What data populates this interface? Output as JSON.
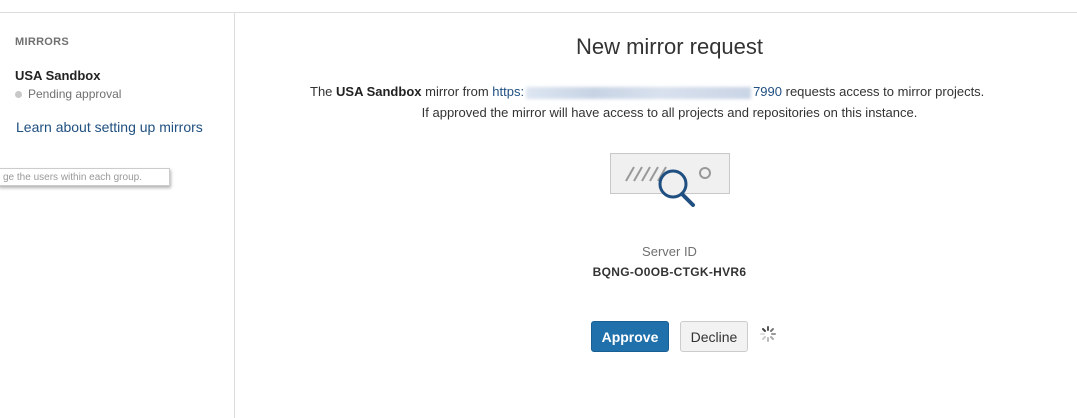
{
  "sidebar": {
    "heading": "MIRRORS",
    "mirror": {
      "name": "USA Sandbox",
      "status": "Pending approval"
    },
    "learn_link": "Learn about setting up mirrors",
    "tooltip_fragment": "ge the users within each group."
  },
  "main": {
    "title": "New mirror request",
    "request": {
      "prefix": "The ",
      "mirror_name": "USA Sandbox",
      "middle": " mirror from ",
      "url_start": "https:",
      "url_port": "7990",
      "suffix": " requests access to mirror projects."
    },
    "note": "If approved the mirror will have access to all projects and repositories on this instance.",
    "server_id_label": "Server ID",
    "server_id": "BQNG-O0OB-CTGK-HVR6",
    "approve_label": "Approve",
    "decline_label": "Decline"
  },
  "colors": {
    "link": "#205081",
    "primary_button": "#2071ab",
    "status_dot": "#c8c8c8"
  },
  "icons": [
    "server-search-illustration",
    "loading-spinner-icon",
    "status-dot-icon"
  ]
}
